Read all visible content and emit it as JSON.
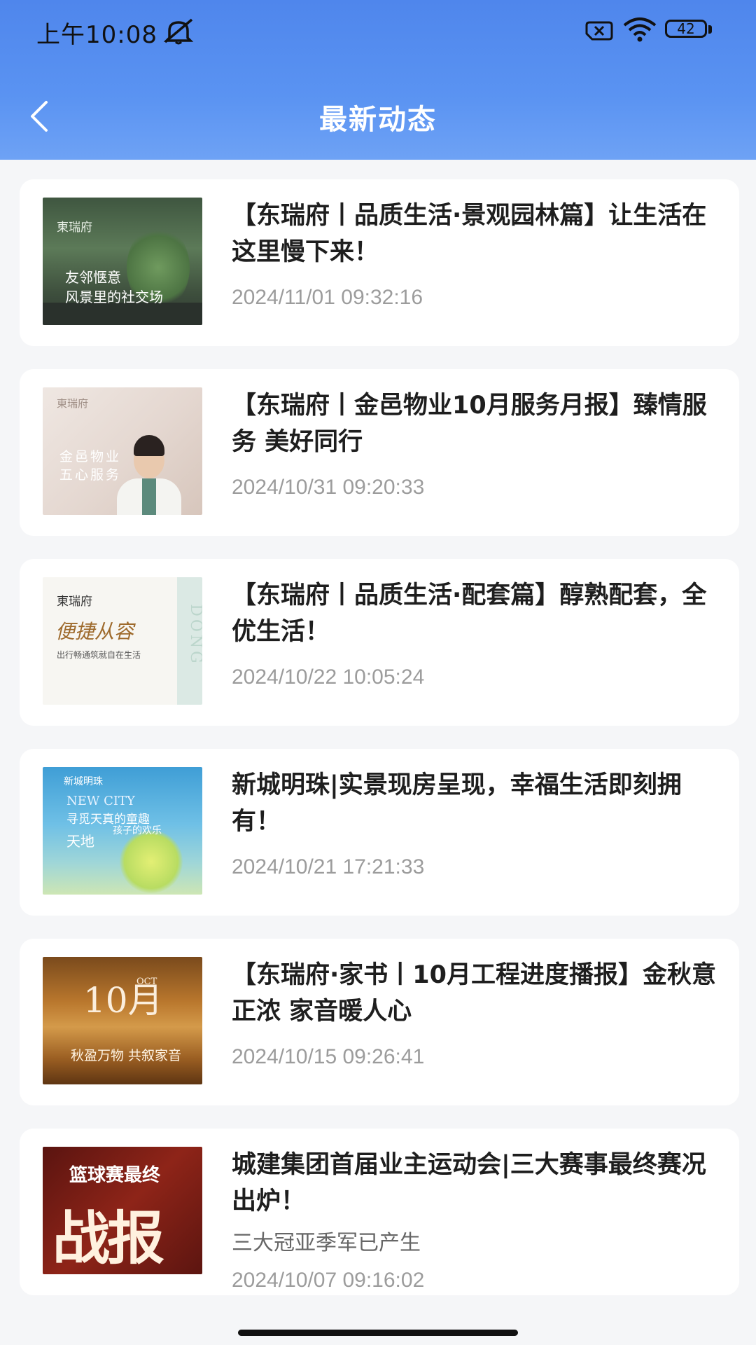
{
  "status": {
    "time": "上午10:08",
    "battery": "42"
  },
  "header": {
    "title": "最新动态"
  },
  "articles": [
    {
      "title": "【东瑞府丨品质生活·景观园林篇】让生活在这里慢下来！",
      "date": "2024/11/01 09:32:16",
      "thumb": {
        "brand": "東瑞府",
        "line1": "友邻惬意",
        "line2": "风景里的社交场"
      }
    },
    {
      "title": "【东瑞府丨金邑物业10月服务月报】臻情服务 美好同行",
      "date": "2024/10/31 09:20:33",
      "thumb": {
        "brand": "東瑞府",
        "line1": "金邑物业",
        "line2": "五心服务"
      }
    },
    {
      "title": "【东瑞府丨品质生活·配套篇】醇熟配套，全优生活！",
      "date": "2024/10/22 10:05:24",
      "thumb": {
        "brand": "東瑞府",
        "line1": "便捷从容",
        "line2": "出行畅通筑就自在生活",
        "side": "DONG"
      }
    },
    {
      "title": "新城明珠|实景现房呈现，幸福生活即刻拥有！",
      "date": "2024/10/21 17:21:33",
      "thumb": {
        "brand": "新城明珠",
        "line1": "NEW CITY",
        "line2": "寻觅天真的童趣",
        "line3": "孩子的欢乐",
        "line4": "天地"
      }
    },
    {
      "title": "【东瑞府·家书丨10月工程进度播报】金秋意正浓 家音暖人心",
      "date": "2024/10/15 09:26:41",
      "thumb": {
        "line1": "10月",
        "line2": "OCT",
        "line3": "秋盈万物 共叙家音"
      }
    },
    {
      "title": "城建集团首届业主运动会|三大赛事最终赛况出炉！",
      "subtitle": "三大冠亚季军已产生",
      "date": "2024/10/07 09:16:02",
      "thumb": {
        "line1": "篮球赛最终",
        "line2": "战报"
      }
    }
  ]
}
